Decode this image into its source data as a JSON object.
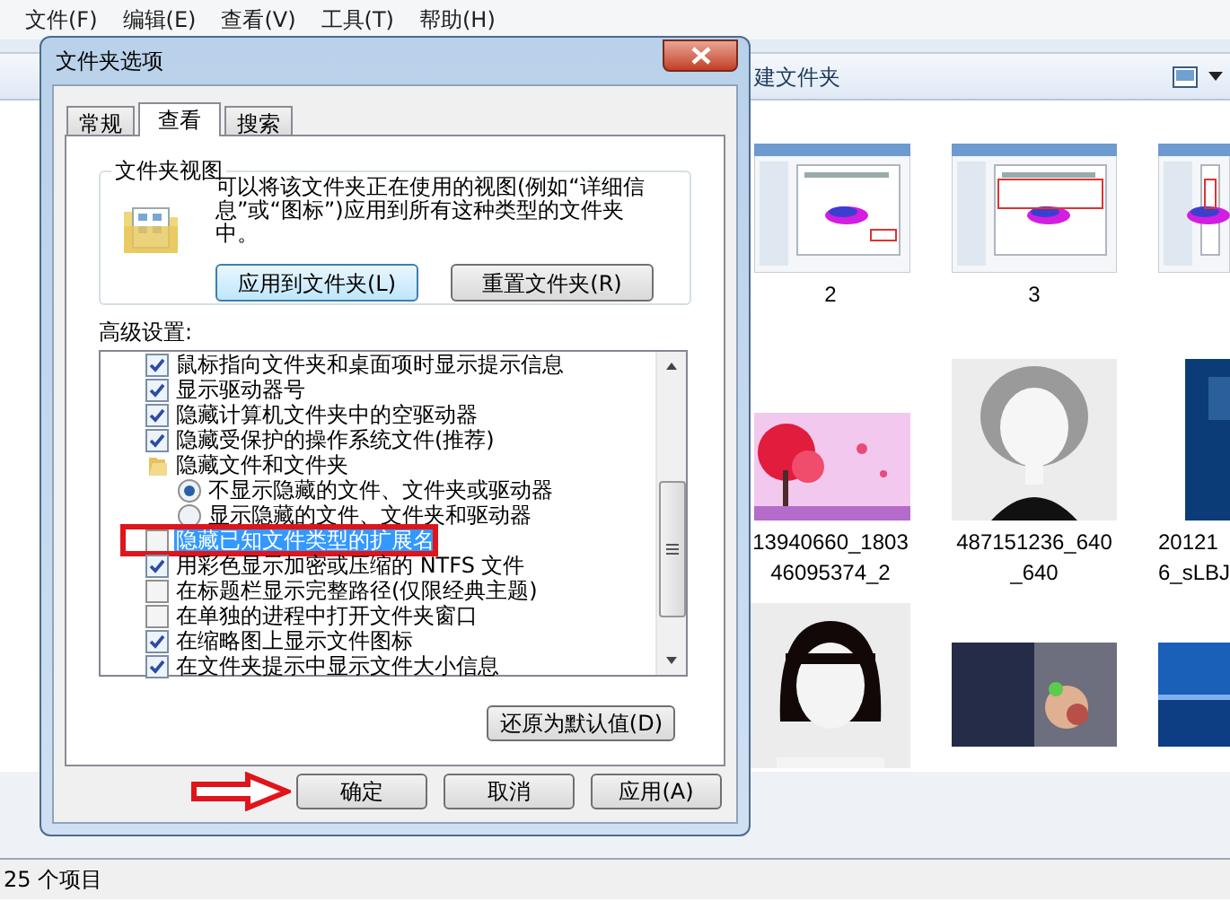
{
  "menu": [
    {
      "label": "文件(F)"
    },
    {
      "label": "编辑(E)"
    },
    {
      "label": "查看(V)"
    },
    {
      "label": "工具(T)"
    },
    {
      "label": "帮助(H)"
    }
  ],
  "toolbar": {
    "new_folder": "建文件夹"
  },
  "files": [
    {
      "kind": "picture",
      "label_lines": [
        "2"
      ]
    },
    {
      "kind": "picture",
      "label_lines": [
        "3"
      ]
    },
    {
      "kind": "picture"
    },
    {
      "kind": "picture",
      "label_lines": [
        "13940660_1803",
        "46095374_2"
      ]
    },
    {
      "kind": "picture",
      "label_lines": [
        "487151236_640",
        "_640"
      ]
    },
    {
      "kind": "picture",
      "label_lines": [
        "20121",
        "6_sLBJ"
      ]
    },
    {
      "kind": "picture"
    },
    {
      "kind": "picture"
    },
    {
      "kind": "picture"
    }
  ],
  "status_bar": "25 个项目",
  "dialog": {
    "title": "文件夹选项",
    "tabs": [
      {
        "label": "常规",
        "selected": false
      },
      {
        "label": "查看",
        "selected": true
      },
      {
        "label": "搜索",
        "selected": false
      }
    ],
    "folder_views": {
      "title": "文件夹视图",
      "description": "可以将该文件夹正在使用的视图(例如“详细信息”或“图标”)应用到所有这种类型的文件夹中。",
      "buttons": [
        {
          "label": "应用到文件夹(L)",
          "focused": true
        },
        {
          "label": "重置文件夹(R)",
          "focused": false
        }
      ]
    },
    "advanced_label": "高级设置:",
    "options": [
      {
        "kind": "checkbox",
        "label": "鼠标指向文件夹和桌面项时显示提示信息",
        "checked": true,
        "selected": false,
        "annotated": false
      },
      {
        "kind": "checkbox",
        "label": "显示驱动器号",
        "checked": true,
        "selected": false,
        "annotated": false
      },
      {
        "kind": "checkbox",
        "label": "隐藏计算机文件夹中的空驱动器",
        "checked": true,
        "selected": false,
        "annotated": false
      },
      {
        "kind": "checkbox",
        "label": "隐藏受保护的操作系统文件(推荐)",
        "checked": true,
        "selected": false,
        "annotated": false
      },
      {
        "kind": "folder",
        "label": "隐藏文件和文件夹",
        "selected": false,
        "annotated": false
      },
      {
        "kind": "radio",
        "label": "不显示隐藏的文件、文件夹或驱动器",
        "checked": true,
        "selected": false,
        "annotated": false
      },
      {
        "kind": "radio",
        "label": "显示隐藏的文件、文件夹和驱动器",
        "checked": false,
        "selected": false,
        "annotated": false
      },
      {
        "kind": "checkbox",
        "label": "隐藏已知文件类型的扩展名",
        "checked": false,
        "selected": true,
        "annotated": true
      },
      {
        "kind": "checkbox",
        "label": "用彩色显示加密或压缩的 NTFS 文件",
        "checked": true,
        "selected": false,
        "annotated": false
      },
      {
        "kind": "checkbox",
        "label": "在标题栏显示完整路径(仅限经典主题)",
        "checked": false,
        "selected": false,
        "annotated": false
      },
      {
        "kind": "checkbox",
        "label": "在单独的进程中打开文件夹窗口",
        "checked": false,
        "selected": false,
        "annotated": false
      },
      {
        "kind": "checkbox",
        "label": "在缩略图上显示文件图标",
        "checked": true,
        "selected": false,
        "annotated": false
      },
      {
        "kind": "checkbox",
        "label": "在文件夹提示中显示文件大小信息",
        "checked": true,
        "selected": false,
        "annotated": false
      }
    ],
    "restore_button": "还原为默认值(D)",
    "buttons": [
      {
        "label": "确定",
        "annotated": true
      },
      {
        "label": "取消",
        "annotated": false
      },
      {
        "label": "应用(A)",
        "annotated": false
      }
    ]
  }
}
